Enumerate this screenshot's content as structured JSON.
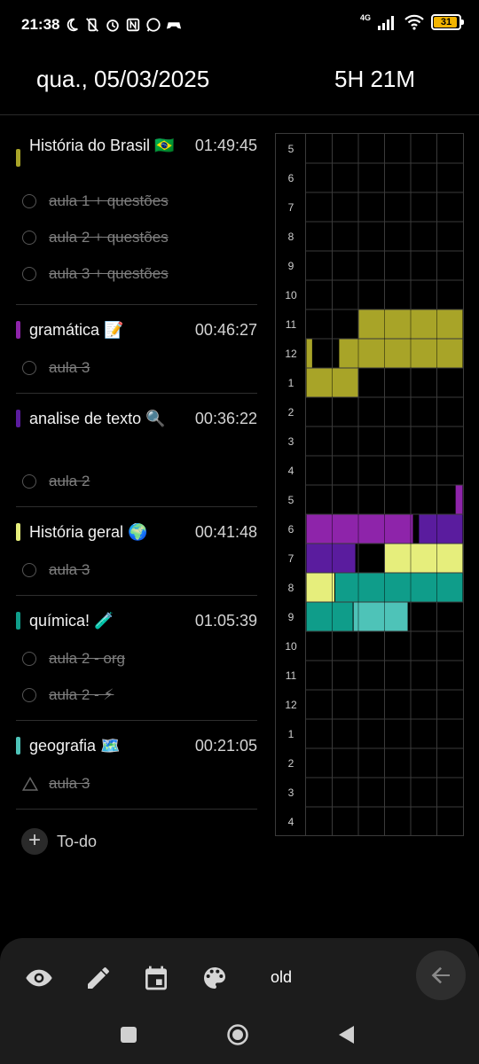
{
  "status": {
    "time": "21:38",
    "network": "4G",
    "battery": "31",
    "icons": [
      "moon-icon",
      "mute-vibrate-icon",
      "alarm-icon",
      "nfc-icon",
      "whatsapp-icon",
      "game-controller-icon",
      "signal-icon",
      "wifi-icon",
      "battery-icon"
    ]
  },
  "header": {
    "date": "qua., 05/03/2025",
    "total": "5H 21M"
  },
  "subjects": [
    {
      "name": "História do Brasil 🇧🇷",
      "time": "01:49:45",
      "color": "#a8a428",
      "tasks": [
        {
          "label": "aula 1 + questões",
          "shape": "circle"
        },
        {
          "label": "aula 2 + questões",
          "shape": "circle"
        },
        {
          "label": "aula 3 + questões",
          "shape": "circle"
        }
      ]
    },
    {
      "name": "gramática 📝",
      "time": "00:46:27",
      "color": "#8e24aa",
      "tasks": [
        {
          "label": "aula 3",
          "shape": "circle"
        }
      ]
    },
    {
      "name": "analise de texto 🔍",
      "time": "00:36:22",
      "color": "#5a1c9e",
      "tasks": [
        {
          "label": "aula 2",
          "shape": "circle"
        }
      ]
    },
    {
      "name": "História geral 🌍",
      "time": "00:41:48",
      "color": "#e6ee7c",
      "tasks": [
        {
          "label": "aula 3",
          "shape": "circle"
        }
      ]
    },
    {
      "name": "química! 🧪",
      "time": "01:05:39",
      "color": "#0f9d8a",
      "tasks": [
        {
          "label": "aula 2 - org",
          "shape": "circle"
        },
        {
          "label": "aula 2 - ⚡",
          "shape": "circle"
        }
      ]
    },
    {
      "name": "geografia 🗺️",
      "time": "00:21:05",
      "color": "#4ec3b8",
      "tasks": [
        {
          "label": "aula 3",
          "shape": "triangle"
        }
      ]
    }
  ],
  "todo_label": "To-do",
  "timeline": {
    "hours": [
      "5",
      "6",
      "7",
      "8",
      "9",
      "10",
      "11",
      "12",
      "1",
      "2",
      "3",
      "4",
      "5",
      "6",
      "7",
      "8",
      "9",
      "10",
      "11",
      "12",
      "1",
      "2",
      "3",
      "4"
    ],
    "segments_per_hour": 6,
    "blocks": [
      {
        "row": 6,
        "start": 2,
        "end": 6,
        "color": "#a8a428"
      },
      {
        "row": 7,
        "start": 0,
        "end": 0.25,
        "color": "#a8a428"
      },
      {
        "row": 7,
        "start": 1.25,
        "end": 6,
        "color": "#a8a428"
      },
      {
        "row": 8,
        "start": 0,
        "end": 2,
        "color": "#a8a428"
      },
      {
        "row": 12,
        "start": 5.7,
        "end": 6,
        "color": "#8e24aa"
      },
      {
        "row": 13,
        "start": 0,
        "end": 4.1,
        "color": "#8e24aa"
      },
      {
        "row": 13,
        "start": 4.3,
        "end": 6,
        "color": "#5a1c9e"
      },
      {
        "row": 14,
        "start": 0,
        "end": 1.9,
        "color": "#5a1c9e"
      },
      {
        "row": 14,
        "start": 3,
        "end": 6,
        "color": "#e6ee7c"
      },
      {
        "row": 15,
        "start": 0,
        "end": 1.1,
        "color": "#e6ee7c"
      },
      {
        "row": 15,
        "start": 1.1,
        "end": 6,
        "color": "#0f9d8a"
      },
      {
        "row": 16,
        "start": 0,
        "end": 1.8,
        "color": "#0f9d8a"
      },
      {
        "row": 16,
        "start": 1.8,
        "end": 3.9,
        "color": "#4ec3b8"
      }
    ]
  },
  "toolbar": {
    "label": "old",
    "icons": [
      "eye-icon",
      "pencil-icon",
      "calendar-icon",
      "palette-icon",
      "arrow-back-icon"
    ]
  }
}
